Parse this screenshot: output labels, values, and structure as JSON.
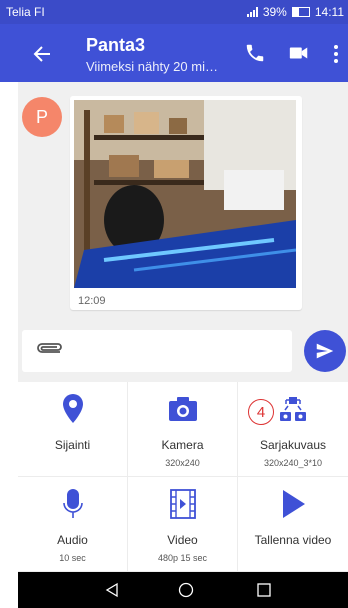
{
  "status_bar": {
    "carrier": "Telia FI",
    "battery": "39%",
    "time": "14:11"
  },
  "header": {
    "title": "Panta3",
    "subtitle": "Viimeksi nähty 20 mi…"
  },
  "chat": {
    "avatar_letter": "P",
    "message_time": "12:09",
    "accent_color": "#3f51d6",
    "avatar_color": "#f5866a"
  },
  "attachments": [
    {
      "id": "location",
      "label": "Sijainti",
      "sub": "",
      "icon": "location-pin-icon"
    },
    {
      "id": "camera",
      "label": "Kamera",
      "sub": "320x240",
      "icon": "camera-icon"
    },
    {
      "id": "burst",
      "label": "Sarjakuvaus",
      "sub": "320x240_3*10",
      "icon": "burst-camera-icon",
      "badge": "4"
    },
    {
      "id": "audio",
      "label": "Audio",
      "sub": "10 sec",
      "icon": "microphone-icon"
    },
    {
      "id": "video",
      "label": "Video",
      "sub": "480p 15 sec",
      "icon": "film-icon"
    },
    {
      "id": "record_video",
      "label": "Tallenna video",
      "sub": "",
      "icon": "play-icon"
    }
  ]
}
